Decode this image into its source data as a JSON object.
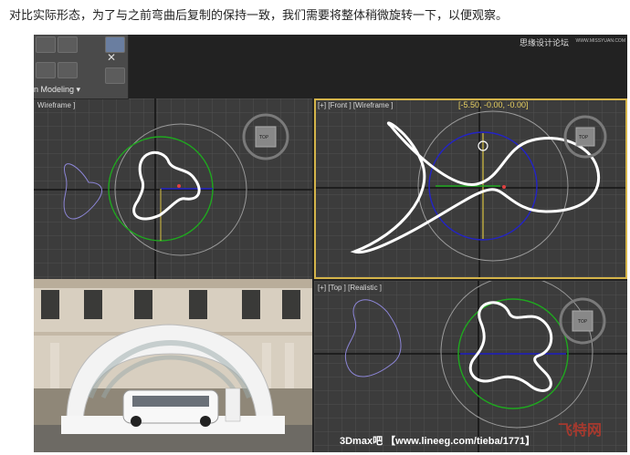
{
  "caption": "对比实际形态，为了与之前弯曲后复制的保持一致，我们需要将整体稍微旋转一下，以便观察。",
  "ribbon": {
    "mode_label": "n Modeling ▾"
  },
  "viewports": {
    "top_left": {
      "label": "Wireframe ]"
    },
    "front": {
      "label": "[+] [Front ] [Wireframe ]",
      "coords": "[-5.50, -0.00, -0.00]"
    },
    "top_right": {
      "label": "[+] [Top ] [Realistic ]"
    }
  },
  "view_cube": {
    "face_label": "TOP"
  },
  "watermarks": {
    "top_site": "思缘设计论坛",
    "top_url": "WWW.MISSYUAN.COM",
    "bottom_text": "3Dmax吧 【www.lineeg.com/tieba/1771】",
    "bottom_logo": "飞特网"
  },
  "colors": {
    "viewport_bg": "#3c3c3c",
    "grid": "#575757",
    "spline": "#ffffff",
    "gizmo_green": "#1fa81f",
    "gizmo_blue": "#2323c8",
    "active_border": "#d4b44a",
    "coords_text": "#e8d060"
  }
}
